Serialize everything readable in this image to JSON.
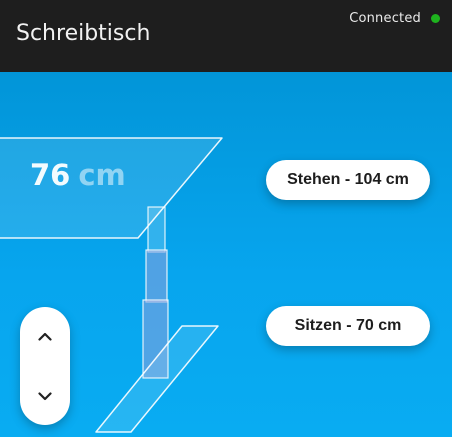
{
  "header": {
    "title": "Schreibtisch",
    "status_text": "Connected",
    "status_color": "#1eb31e"
  },
  "desk": {
    "current_height": "76",
    "unit": "cm"
  },
  "presets": {
    "stand_label": "Stehen - 104 cm",
    "sit_label": "Sitzen - 70 cm"
  },
  "controls": {
    "up_icon": "chevron-up-icon",
    "down_icon": "chevron-down-icon"
  },
  "colors": {
    "header_bg": "#1e1e1e",
    "content_bg": "#07a5ee",
    "accent_white": "#ffffff"
  }
}
